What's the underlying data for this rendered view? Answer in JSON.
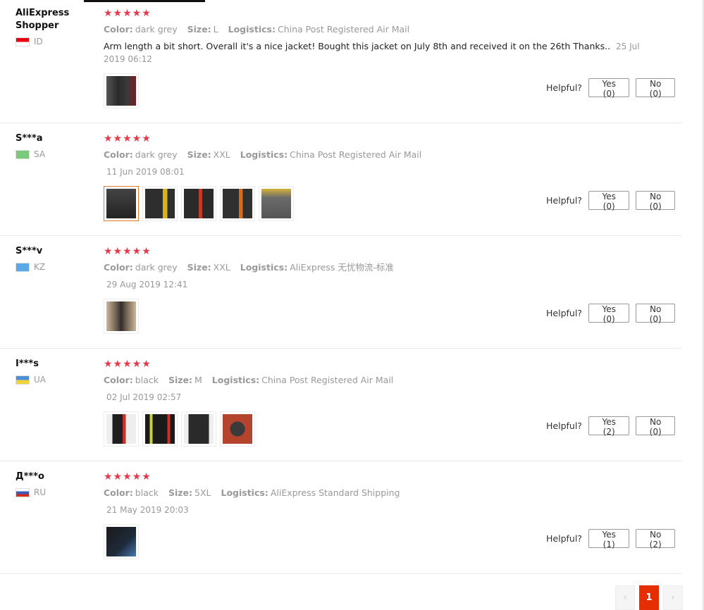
{
  "helpful_label": "Helpful?",
  "reviews": [
    {
      "user": "AliExpress Shopper",
      "country": "ID",
      "flag_colors": [
        "#e70011",
        "#ffffff"
      ],
      "stars": "★★★★★",
      "color_label": "Color:",
      "color": "dark grey",
      "size_label": "Size:",
      "size": "L",
      "logistics_label": "Logistics:",
      "logistics": "China Post Registered Air Mail",
      "text": "Arm length a bit short. Overall it's a nice jacket! Bought this jacket on July 8th and received it on the 26th Thanks..",
      "date": "25 Jul 2019 06:12",
      "yes": "Yes (0)",
      "no": "No (0)",
      "thumb_colors": [
        "#3a3a3a"
      ]
    },
    {
      "user": "S***a",
      "country": "SA",
      "flag_colors": [
        "#7bc97b",
        "#a8dca8"
      ],
      "stars": "★★★★★",
      "color_label": "Color:",
      "color": "dark grey",
      "size_label": "Size:",
      "size": "XXL",
      "logistics_label": "Logistics:",
      "logistics": "China Post Registered Air Mail",
      "date": "11 Jun 2019 08:01",
      "yes": "Yes (0)",
      "no": "No (0)",
      "thumb_colors": [
        "#2f2f2f",
        "#353535",
        "#2a2a2a",
        "#303030",
        "#6b6b6b"
      ]
    },
    {
      "user": "S***v",
      "country": "KZ",
      "flag_colors": [
        "#5aa9e6",
        "#8cc6ef"
      ],
      "stars": "★★★★★",
      "color_label": "Color:",
      "color": "dark grey",
      "size_label": "Size:",
      "size": "XXL",
      "logistics_label": "Logistics:",
      "logistics": "AliExpress 无忧物流-标准",
      "date": "29 Aug 2019 12:41",
      "yes": "Yes (0)",
      "no": "No (0)",
      "thumb_colors": [
        "#a08c78"
      ]
    },
    {
      "user": "I***s",
      "country": "UA",
      "flag_colors": [
        "#4d8fd6",
        "#f2d23c"
      ],
      "stars": "★★★★★",
      "color_label": "Color:",
      "color": "black",
      "size_label": "Size:",
      "size": "M",
      "logistics_label": "Logistics:",
      "logistics": "China Post Registered Air Mail",
      "date": "02 Jul 2019 02:57",
      "yes": "Yes (2)",
      "no": "No (0)",
      "thumb_colors": [
        "#262626",
        "#202020",
        "#2a2a2a",
        "#b5442e"
      ]
    },
    {
      "user": "Д***о",
      "country": "RU",
      "flag_colors": [
        "#ffffff",
        "#3b5bb5",
        "#d52b1e"
      ],
      "stars": "★★★★★",
      "color_label": "Color:",
      "color": "black",
      "size_label": "Size:",
      "size": "5XL",
      "logistics_label": "Logistics:",
      "logistics": "AliExpress Standard Shipping",
      "date": "21 May 2019 20:03",
      "yes": "Yes (1)",
      "no": "No (2)",
      "thumb_colors": [
        "#1e2a3a"
      ]
    }
  ],
  "pagination": {
    "prev": "‹",
    "current": "1",
    "next": "›"
  }
}
